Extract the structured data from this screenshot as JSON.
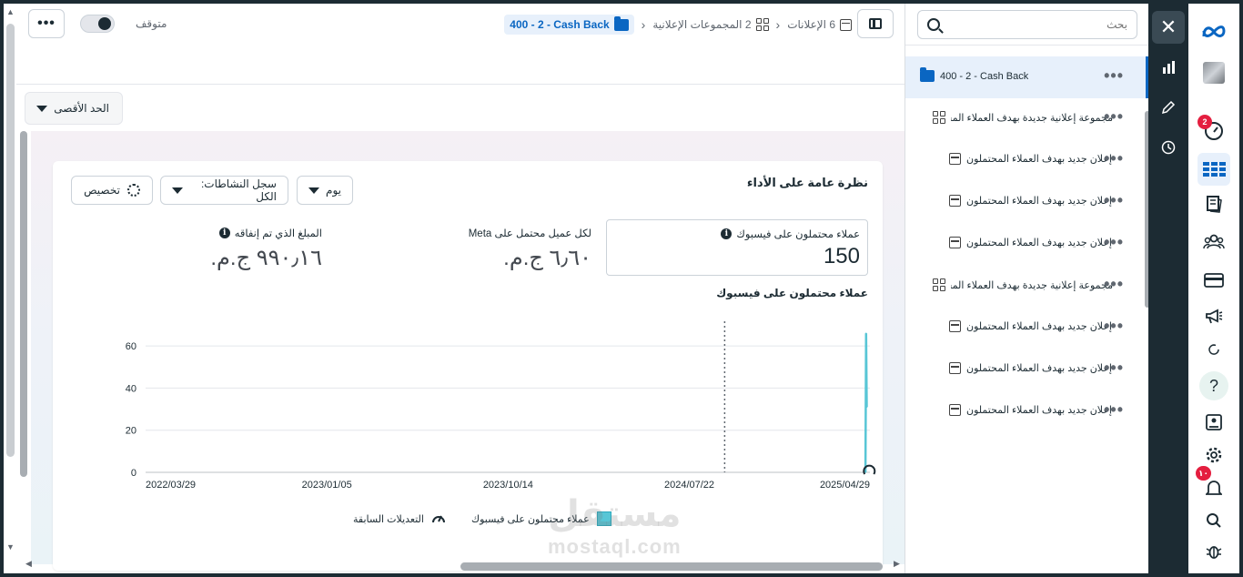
{
  "topbar": {
    "more_label": "•••",
    "status": "متوقف",
    "breadcrumbs": [
      {
        "label": "400 - 2 - Cash Back",
        "icon": "folder-icon"
      },
      {
        "label": "2 المجموعات الإعلانية",
        "icon": "grid-icon"
      },
      {
        "label": "6 الإعلانات",
        "icon": "ad-icon"
      }
    ]
  },
  "max_dropdown": "الحد الأقصى",
  "card": {
    "title": "نظرة عامة على الأداء",
    "controls": {
      "day": "يوم",
      "activity_log": "سجل النشاطات: الكل",
      "customize": "تخصيص"
    },
    "metrics": [
      {
        "label": "عملاء محتملون على فيسبوك",
        "value": "150"
      },
      {
        "label": "لكل عميل محتمل على Meta",
        "value": "٦٫٦٠ ج.م.‏"
      },
      {
        "label": "المبلغ الذي تم إنفاقه",
        "value": "٩٩٠٫١٦ ج.م.‏"
      }
    ],
    "chart_title": "عملاء محتملون على فيسبوك"
  },
  "chart_data": {
    "type": "line",
    "title": "عملاء محتملون على فيسبوك",
    "x_ticks": [
      "2022/03/29",
      "2023/01/05",
      "2023/10/14",
      "2024/07/22",
      "2025/04/29"
    ],
    "y_ticks": [
      0,
      20,
      40,
      60
    ],
    "ylim": [
      0,
      70
    ],
    "series": [
      {
        "name": "عملاء محتملون على فيسبوك",
        "color": "#58c6d6",
        "points": [
          [
            "2025/04/22",
            0
          ],
          [
            "2025/04/23",
            66
          ],
          [
            "2025/04/24",
            31
          ]
        ]
      }
    ],
    "marker_line_date": "2024/09/15",
    "annotation_date": "2025/04/28",
    "legend": [
      "عملاء محتملون على فيسبوك",
      "التعديلات السابقة"
    ],
    "legend_position": "bottom"
  },
  "legend": {
    "series_label": "عملاء محتملون على فيسبوك",
    "edits_label": "التعديلات السابقة"
  },
  "watermark": {
    "line1": "مستقل",
    "line2": "mostaql.com"
  },
  "tree": {
    "search_placeholder": "بحث",
    "rows": [
      {
        "label": "400 - 2 - Cash Back",
        "icon": "folder-icon",
        "level": 0,
        "selected": true
      },
      {
        "label": "مجموعة إعلانية جديدة بهدف العملاء المحتملون - نسخة",
        "icon": "grid-icon",
        "level": 1
      },
      {
        "label": "إعلان جديد بهدف العملاء المحتملون - نسخة - نسخة",
        "icon": "ad-icon",
        "level": 2
      },
      {
        "label": "إعلان جديد بهدف العملاء المحتملون",
        "icon": "ad-icon",
        "level": 2
      },
      {
        "label": "إعلان جديد بهدف العملاء المحتملون - نسخة",
        "icon": "ad-icon",
        "level": 2
      },
      {
        "label": "مجموعة إعلانية جديدة بهدف العملاء المحتملون",
        "icon": "grid-icon",
        "level": 1
      },
      {
        "label": "إعلان جديد بهدف العملاء المحتملون - نسخة - نسخة",
        "icon": "ad-icon",
        "level": 2
      },
      {
        "label": "إعلان جديد بهدف العملاء المحتملون - نسخة",
        "icon": "ad-icon",
        "level": 2
      },
      {
        "label": "إعلان جديد بهدف العملاء المحتملون",
        "icon": "ad-icon",
        "level": 2
      }
    ]
  },
  "nav": {
    "notifications_badge": "2",
    "alerts_badge": "١٠",
    "help": "?"
  },
  "colors": {
    "accent": "#0a66c2",
    "series": "#58c6d6",
    "dark": "#1c2b33",
    "badge": "#e41e3f"
  }
}
